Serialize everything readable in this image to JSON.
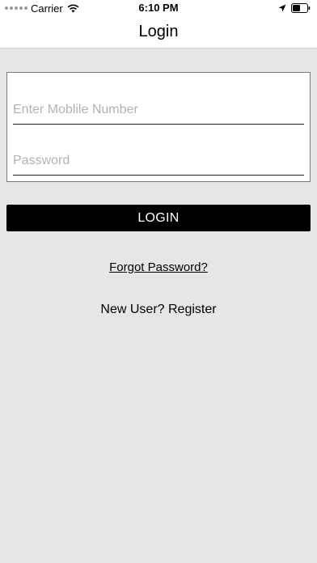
{
  "status_bar": {
    "carrier": "Carrier",
    "time": "6:10 PM"
  },
  "header": {
    "title": "Login"
  },
  "form": {
    "mobile_placeholder": "Enter Moblile Number",
    "mobile_value": "",
    "password_placeholder": "Password",
    "password_value": "",
    "login_label": "LOGIN"
  },
  "links": {
    "forgot_password": "Forgot Password?",
    "register": "New User? Register"
  },
  "icons": {
    "signal": "signal-dots-icon",
    "wifi": "wifi-icon",
    "location": "location-arrow-icon",
    "battery": "battery-icon"
  },
  "colors": {
    "background": "#e6e6e6",
    "button": "#000000",
    "button_text": "#ffffff"
  }
}
